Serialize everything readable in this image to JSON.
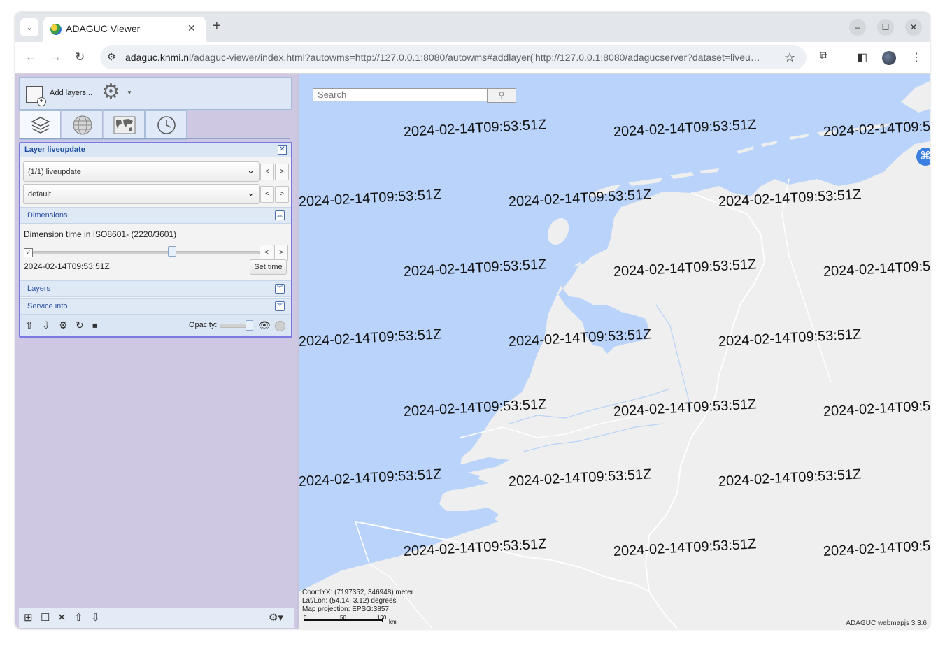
{
  "browser": {
    "tab_title": "ADAGUC Viewer",
    "tab_close": "✕",
    "new_tab": "+",
    "tab_dropdown": "⌄",
    "url_host": "adaguc.knmi.nl",
    "url_rest": "/adaguc-viewer/index.html?autowms=http://127.0.0.1:8080/autowms#addlayer('http://127.0.0.1:8080/adagucserver?dataset=liveu…",
    "minimize": "–",
    "maximize": "☐",
    "close": "✕"
  },
  "toppanel": {
    "add_layers_label": "Add layers..."
  },
  "layer_panel": {
    "title": "Layer liveupdate",
    "layer_select": "(1/1) liveupdate",
    "style_select": "default",
    "prev": "<",
    "next": ">",
    "dimensions_title": "Dimensions",
    "dimension_text": "Dimension time in ISO8601- (2220/3601)",
    "slider_fraction": 0.617,
    "time_value": "2024-02-14T09:53:51Z",
    "set_time_label": "Set time",
    "layers_title": "Layers",
    "service_info_title": "Service info",
    "opacity_label": "Opacity:"
  },
  "map": {
    "search_placeholder": "Search",
    "stamp_text": "2024-02-14T09:53:51Z",
    "coord_line1": "CoordYX: (7197352, 346948) meter",
    "coord_line2": "Lat/Lon: (54.14, 3.12)  degrees",
    "coord_line3": "Map projection: EPSG:3857",
    "scale_0": "0",
    "scale_50": "50",
    "scale_100": "100",
    "scale_unit": "km",
    "copyright": "ADAGUC webmapjs 3.3.6",
    "sea_color": "#b9d3fa",
    "land_color": "#efefef"
  }
}
